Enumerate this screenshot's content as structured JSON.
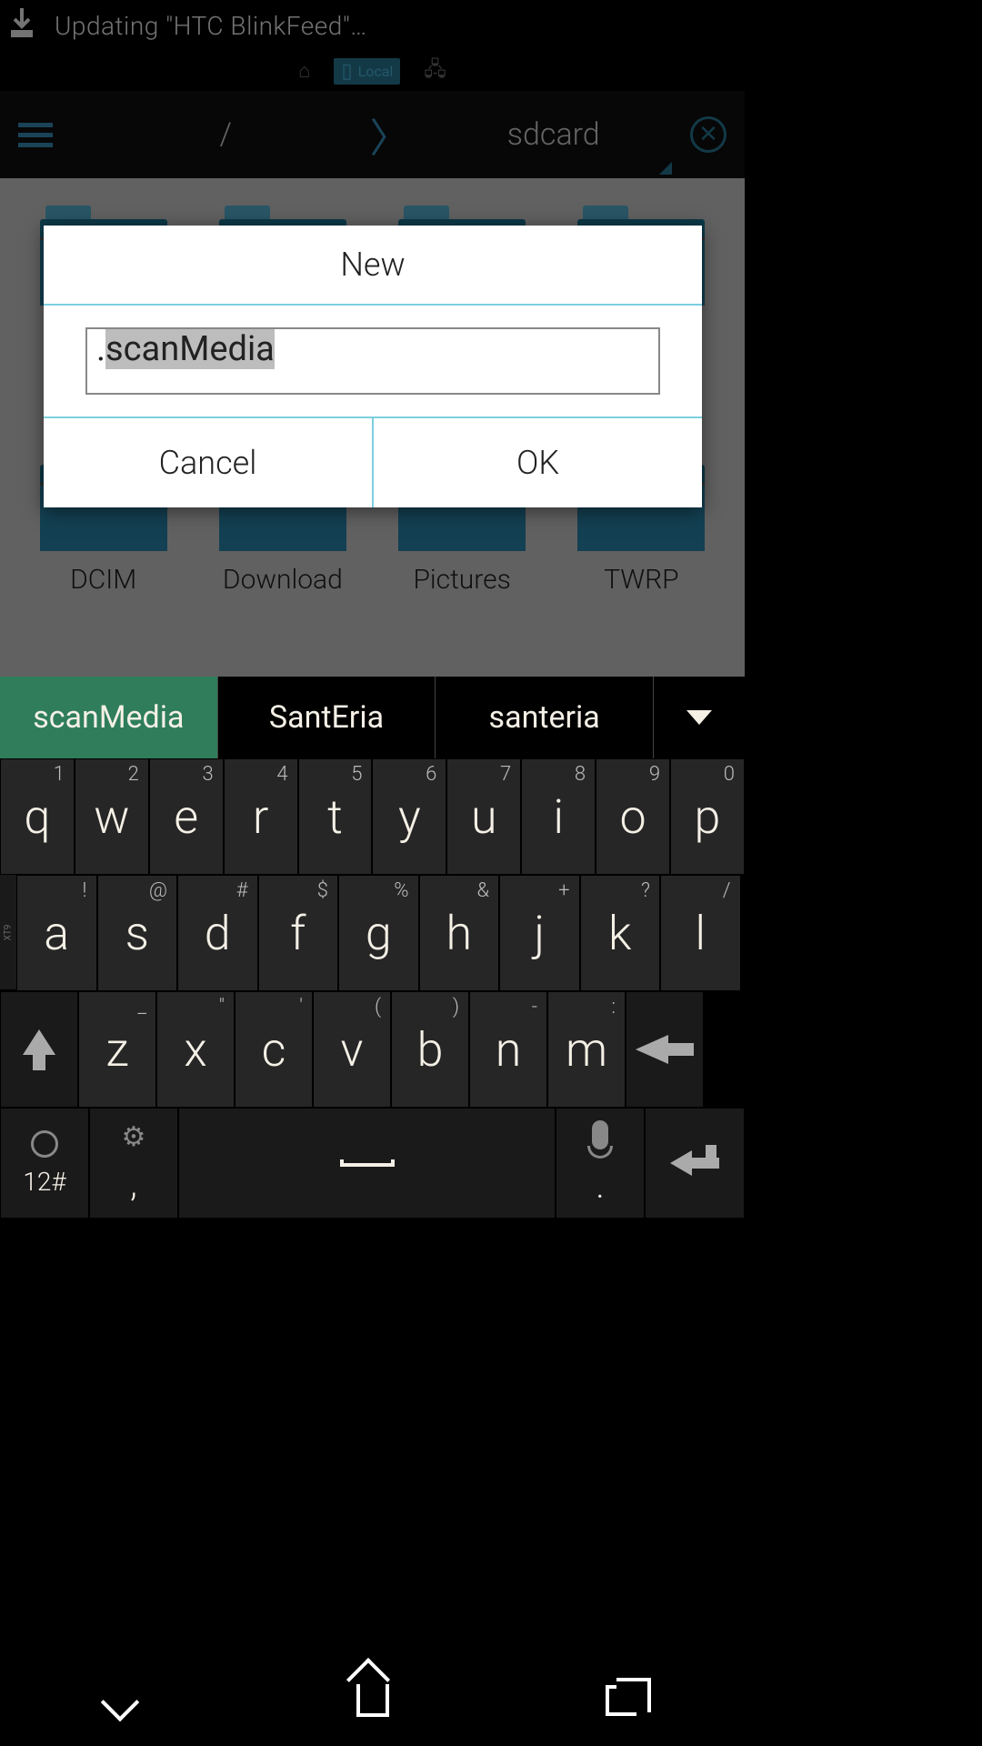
{
  "status": {
    "text": "Updating \"HTC BlinkFeed\"…"
  },
  "locationTabs": {
    "local": "Local"
  },
  "path": {
    "root": "/",
    "current": "sdcard"
  },
  "folders": {
    "row1": [
      "",
      "",
      "",
      ""
    ],
    "row2": [
      "DCIM",
      "Download",
      "Pictures",
      "TWRP"
    ]
  },
  "dialog": {
    "title": "New",
    "input_prefix": ".",
    "input_value": "scanMedia",
    "cancel": "Cancel",
    "ok": "OK"
  },
  "suggestions": {
    "s1": "scanMedia",
    "s2": "SantEria",
    "s3": "santeria"
  },
  "keyboard": {
    "row1": [
      {
        "m": "q",
        "h": "1"
      },
      {
        "m": "w",
        "h": "2"
      },
      {
        "m": "e",
        "h": "3"
      },
      {
        "m": "r",
        "h": "4"
      },
      {
        "m": "t",
        "h": "5"
      },
      {
        "m": "y",
        "h": "6"
      },
      {
        "m": "u",
        "h": "7"
      },
      {
        "m": "i",
        "h": "8"
      },
      {
        "m": "o",
        "h": "9"
      },
      {
        "m": "p",
        "h": "0"
      }
    ],
    "row2": [
      {
        "m": "a",
        "h": "!"
      },
      {
        "m": "s",
        "h": "@"
      },
      {
        "m": "d",
        "h": "#"
      },
      {
        "m": "f",
        "h": "$"
      },
      {
        "m": "g",
        "h": "%"
      },
      {
        "m": "h",
        "h": "&"
      },
      {
        "m": "j",
        "h": "+"
      },
      {
        "m": "k",
        "h": "?"
      },
      {
        "m": "l",
        "h": "/"
      }
    ],
    "row3": [
      {
        "m": "z",
        "h": "_"
      },
      {
        "m": "x",
        "h": "\""
      },
      {
        "m": "c",
        "h": "'"
      },
      {
        "m": "v",
        "h": "("
      },
      {
        "m": "b",
        "h": ")"
      },
      {
        "m": "n",
        "h": "-"
      },
      {
        "m": "m",
        "h": ":"
      }
    ],
    "numLabel": "12#",
    "comma": ",",
    "period": "."
  }
}
